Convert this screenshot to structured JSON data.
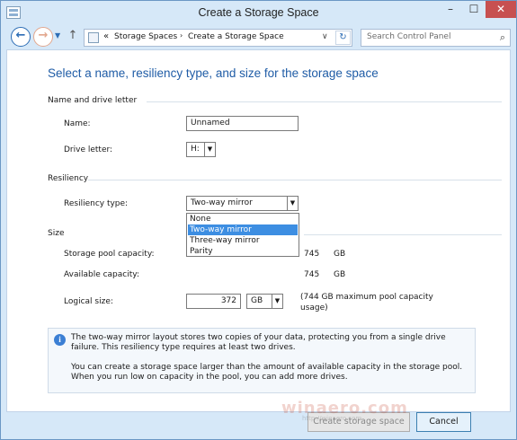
{
  "window": {
    "title": "Create a Storage Space",
    "controls": {
      "minimize": "–",
      "maximize": "☐",
      "close": "✕"
    }
  },
  "navigation": {
    "back_glyph": "←",
    "forward_glyph": "→",
    "recent_glyph": "▼",
    "up_glyph": "↑",
    "address_chevron": "«",
    "breadcrumbs": [
      "Storage Spaces",
      "Create a Storage Space"
    ],
    "breadcrumb_separator": "›",
    "address_dropdown_glyph": "∨",
    "refresh_glyph": "↻",
    "search_placeholder": "Search Control Panel",
    "search_icon": "⌕"
  },
  "page": {
    "heading": "Select a name, resiliency type, and size for the storage space",
    "sections": {
      "name_drive": "Name and drive letter",
      "resiliency": "Resiliency",
      "size": "Size"
    },
    "name": {
      "label": "Name:",
      "value": "Unnamed"
    },
    "drive_letter": {
      "label": "Drive letter:",
      "value": "H:",
      "dropdown_glyph": "▼"
    },
    "resiliency_type": {
      "label": "Resiliency type:",
      "value": "Two-way mirror",
      "dropdown_glyph": "▼",
      "options": [
        "None",
        "Two-way mirror",
        "Three-way mirror",
        "Parity"
      ],
      "highlighted_option": "Two-way mirror"
    },
    "storage_pool_capacity": {
      "label": "Storage pool capacity:",
      "value": "745",
      "unit": "GB"
    },
    "available_capacity": {
      "label": "Available capacity:",
      "value": "745",
      "unit": "GB"
    },
    "logical_size": {
      "label": "Logical size:",
      "value": "372",
      "unit": "GB",
      "unit_dropdown_glyph": "▼",
      "note": "(744 GB maximum pool capacity usage)"
    },
    "info": {
      "icon_glyph": "i",
      "paragraph1": "The two-way mirror layout stores two copies of your data, protecting you from a single drive failure. This resiliency type requires at least two drives.",
      "paragraph2": "You can create a storage space larger than the amount of available capacity in the storage pool. When you run low on capacity in the pool, you can add more drives."
    }
  },
  "footer": {
    "create_label": "Create storage space",
    "cancel_label": "Cancel"
  },
  "watermark": {
    "text": "winaero.com",
    "sub": "http://winaero.com"
  },
  "colors": {
    "heading": "#1f5ca6",
    "selection": "#3d8ee2",
    "close_button": "#c75050",
    "window_frame": "#d6e8f8"
  }
}
